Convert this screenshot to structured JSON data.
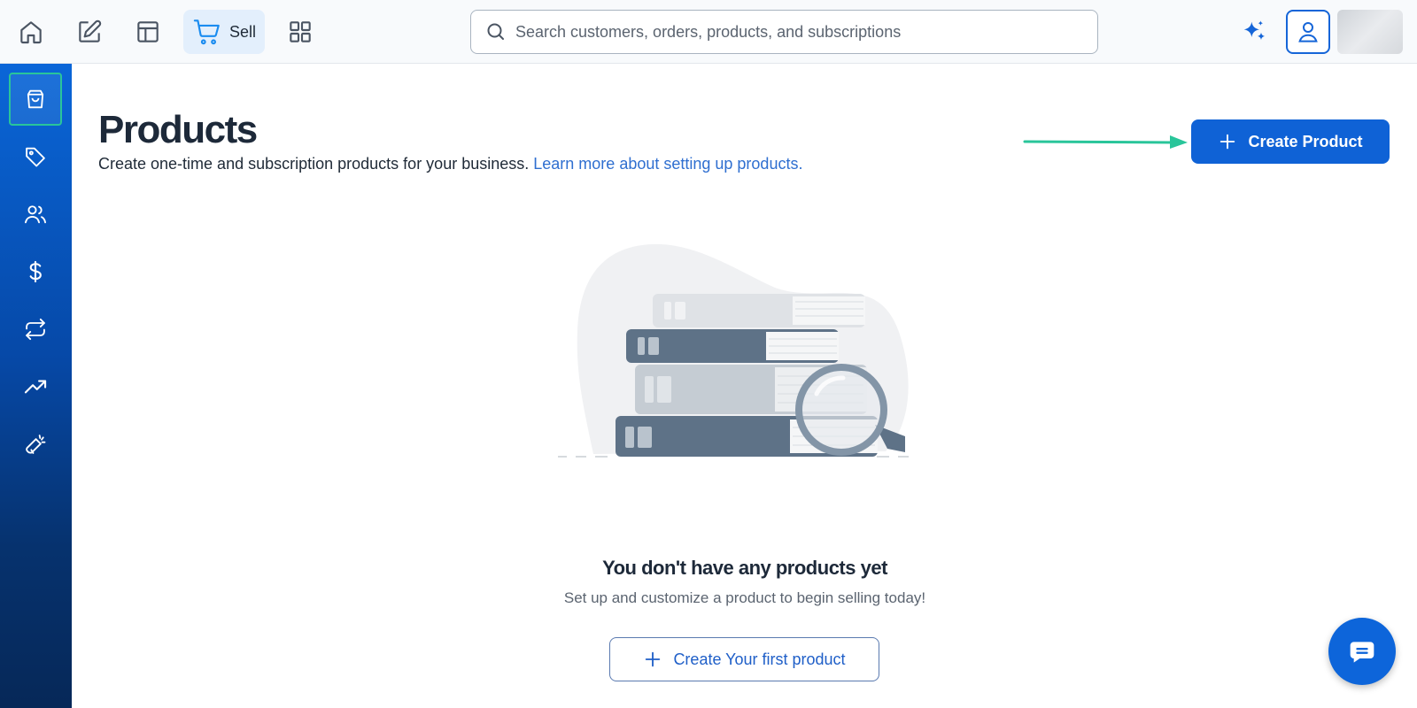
{
  "topbar": {
    "icons": [
      "home-icon",
      "edit-icon",
      "layout-icon",
      "cart-icon",
      "grid-icon"
    ],
    "sell_label": "Sell",
    "search_placeholder": "Search customers, orders, products, and subscriptions"
  },
  "sidebar": {
    "items": [
      {
        "icon": "shopping-bag-icon",
        "active": true
      },
      {
        "icon": "tag-icon",
        "active": false
      },
      {
        "icon": "users-icon",
        "active": false
      },
      {
        "icon": "dollar-icon",
        "active": false
      },
      {
        "icon": "repeat-icon",
        "active": false
      },
      {
        "icon": "trending-up-icon",
        "active": false
      },
      {
        "icon": "megaphone-icon",
        "active": false
      }
    ]
  },
  "main": {
    "title": "Products",
    "subtitle": "Create one-time and subscription products for your business.",
    "learn_link": "Learn more about setting up products.",
    "create_button": "Create Product",
    "empty_title": "You don't have any products yet",
    "empty_subtitle": "Set up and customize a product to begin selling today!",
    "first_product_button": "Create Your first product"
  },
  "colors": {
    "primary": "#0f62d6",
    "sidebar_top": "#0a66d8",
    "sidebar_bottom": "#062858",
    "active_outline": "#29c59a",
    "arrow": "#29c59a",
    "link": "#2f6fd0"
  }
}
